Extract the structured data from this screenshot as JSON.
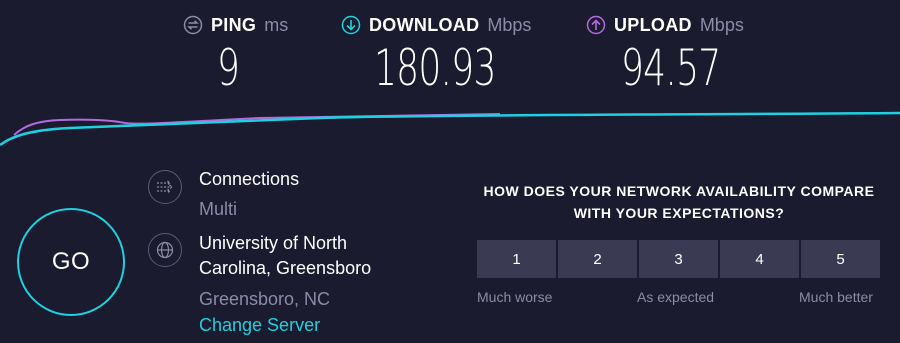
{
  "metrics": {
    "ping": {
      "label": "PING",
      "unit": "ms",
      "value": "9",
      "icon": "ping-icon",
      "color": "#8a8ca8"
    },
    "download": {
      "label": "DOWNLOAD",
      "unit": "Mbps",
      "value": "180.93",
      "icon": "download-arrow-icon",
      "color": "#1fd0e0"
    },
    "upload": {
      "label": "UPLOAD",
      "unit": "Mbps",
      "value": "94.57",
      "icon": "upload-arrow-icon",
      "color": "#b46be0"
    }
  },
  "go_button": {
    "label": "GO"
  },
  "connection": {
    "label": "Connections",
    "value": "Multi",
    "icon": "connections-icon"
  },
  "server": {
    "name": "University of North Carolina, Greensboro",
    "location": "Greensboro, NC",
    "change_label": "Change Server",
    "icon": "globe-icon"
  },
  "survey": {
    "question": "HOW DOES YOUR NETWORK AVAILABILITY COMPARE WITH YOUR EXPECTATIONS?",
    "options": [
      "1",
      "2",
      "3",
      "4",
      "5"
    ],
    "low_label": "Much worse",
    "mid_label": "As expected",
    "high_label": "Much better"
  },
  "colors": {
    "background": "#1a1b2e",
    "accent_cyan": "#1fd0e0",
    "accent_purple": "#b46be0",
    "muted_text": "#8a8ca8",
    "rating_button": "#3a3b52"
  }
}
